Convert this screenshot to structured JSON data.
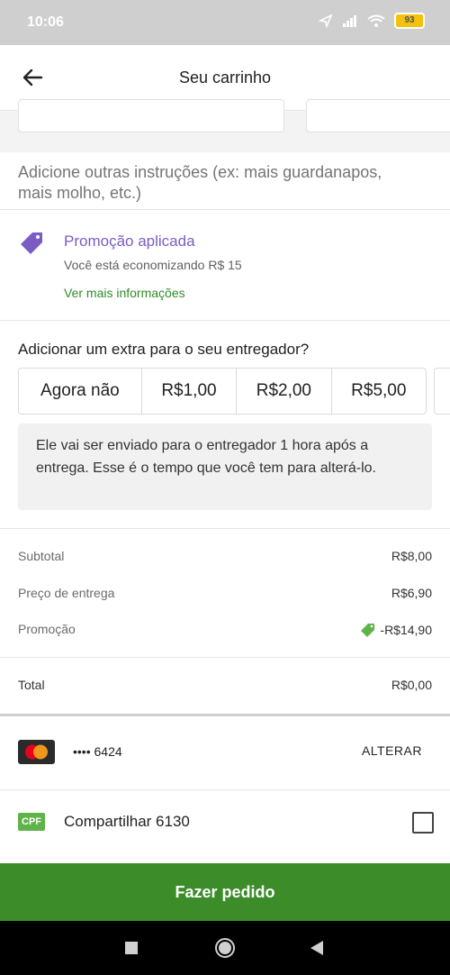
{
  "status_bar": {
    "time": "10:06",
    "battery": "93"
  },
  "header": {
    "title": "Seu carrinho"
  },
  "instructions": {
    "placeholder": "Adicione outras instruções (ex: mais guardanapos, mais molho, etc.)"
  },
  "promotion": {
    "title": "Promoção aplicada",
    "description": "Você está economizando R$ 15",
    "link": "Ver mais informações"
  },
  "tip": {
    "question": "Adicionar um extra para o seu entregador?",
    "options": [
      "Agora não",
      "R$1,00",
      "R$2,00",
      "R$5,00"
    ],
    "note": "Ele vai ser enviado para o entregador 1 hora após a entrega. Esse é o tempo que você tem para alterá-lo."
  },
  "summary": {
    "subtotal_label": "Subtotal",
    "subtotal_value": "R$8,00",
    "delivery_label": "Preço de entrega",
    "delivery_value": "R$6,90",
    "promo_label": "Promoção",
    "promo_value": "-R$14,90",
    "total_label": "Total",
    "total_value": "R$0,00"
  },
  "payment": {
    "card_number": "•••• 6424",
    "change_label": "ALTERAR"
  },
  "cpf": {
    "badge": "CPF",
    "label": "Compartilhar 6130"
  },
  "order_button": {
    "label": "Fazer pedido"
  },
  "colors": {
    "accent_green": "#3c8c2a",
    "promo_purple": "#7b5cc4",
    "status_bar": "#cfcfcf"
  }
}
